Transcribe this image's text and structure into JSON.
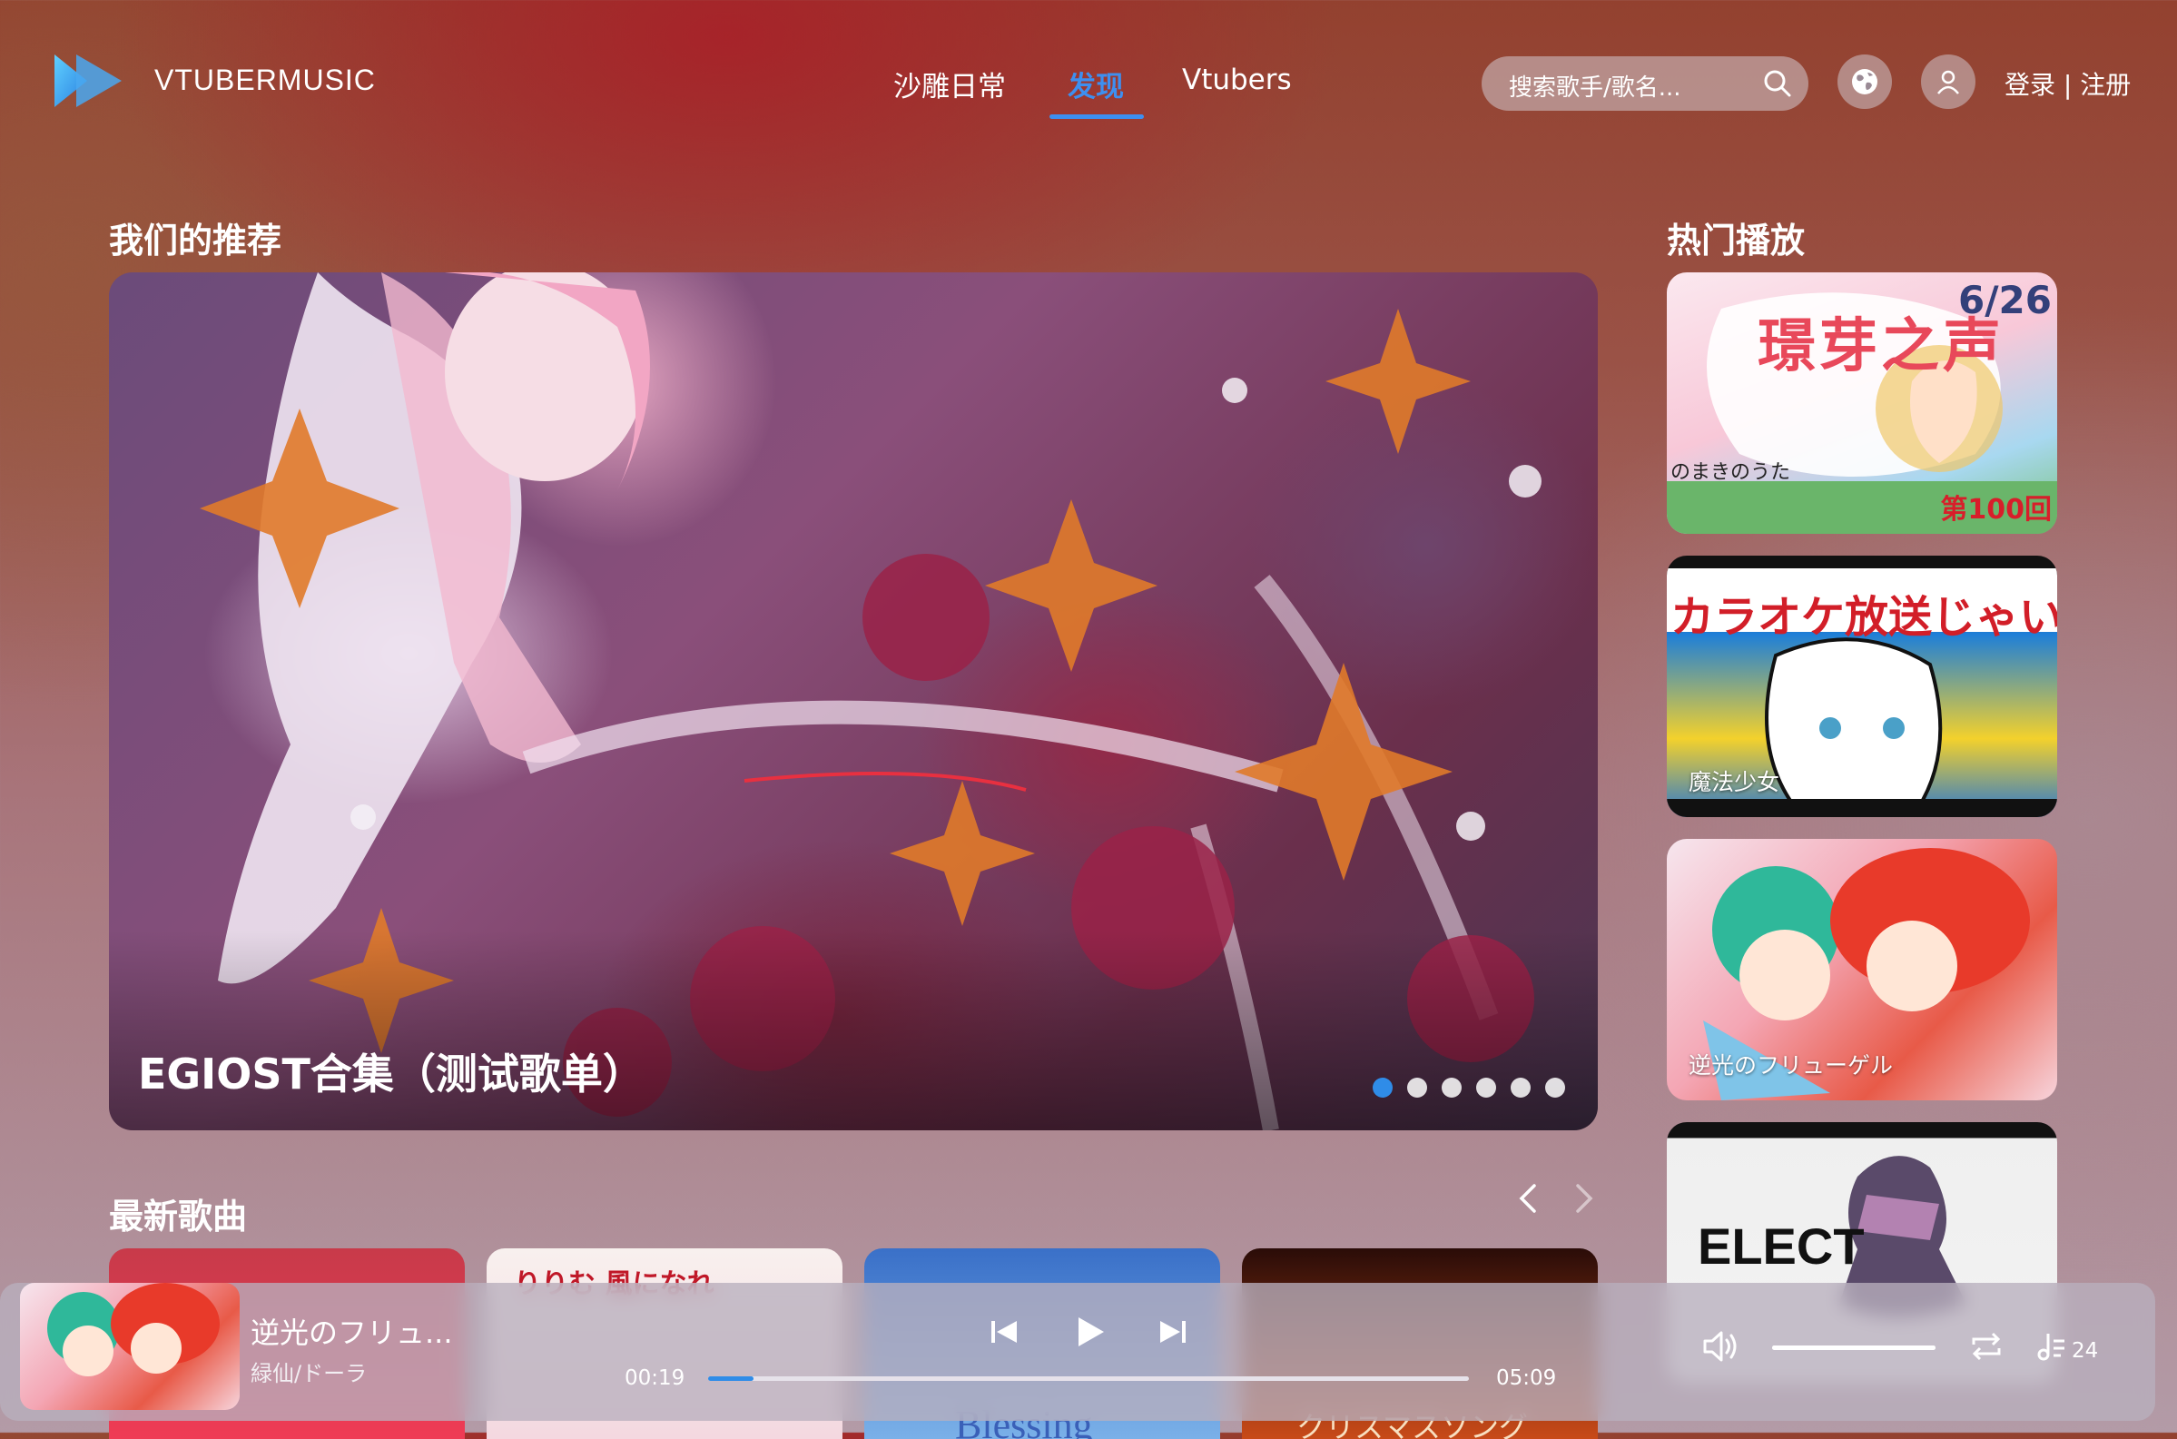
{
  "header": {
    "brand": "VTUBERMUSIC",
    "nav": [
      "沙雕日常",
      "发现",
      "Vtubers"
    ],
    "active_nav": "发现",
    "search_placeholder": "搜索歌手/歌名...",
    "login_label": "登录 | 注册",
    "icons": [
      "logo-play-icon",
      "search-icon",
      "globe-icon",
      "user-icon"
    ]
  },
  "recommend": {
    "title": "我们的推荐",
    "banner_caption": "EGIOST合集（测试歌单）",
    "dot_count": 6,
    "active_dot": 0
  },
  "hot": {
    "title": "热门播放",
    "cards": [
      {
        "label": "のまきのうた",
        "overlay_text": "6/26",
        "badge": "第100回",
        "big_text": "璟芽之声"
      },
      {
        "label": "魔法少女",
        "big_text": "カラオケ放送じゃい"
      },
      {
        "label": "逆光のフリューゲル"
      },
      {
        "label": "",
        "big_text": "ELECT"
      }
    ]
  },
  "latest": {
    "title": "最新歌曲",
    "cards": [
      "",
      "りりむ 風になれ",
      "Blessing",
      "クリスマスソング"
    ]
  },
  "player": {
    "title": "逆光のフリュ...",
    "artist": "緑仙/ドーラ",
    "current_time": "00:19",
    "total_time": "05:09",
    "progress": 0.06,
    "volume": 1.0,
    "playlist_count": "24"
  },
  "colors": {
    "accent": "#2f8ce8",
    "nav_active": "#3d8ff0"
  }
}
